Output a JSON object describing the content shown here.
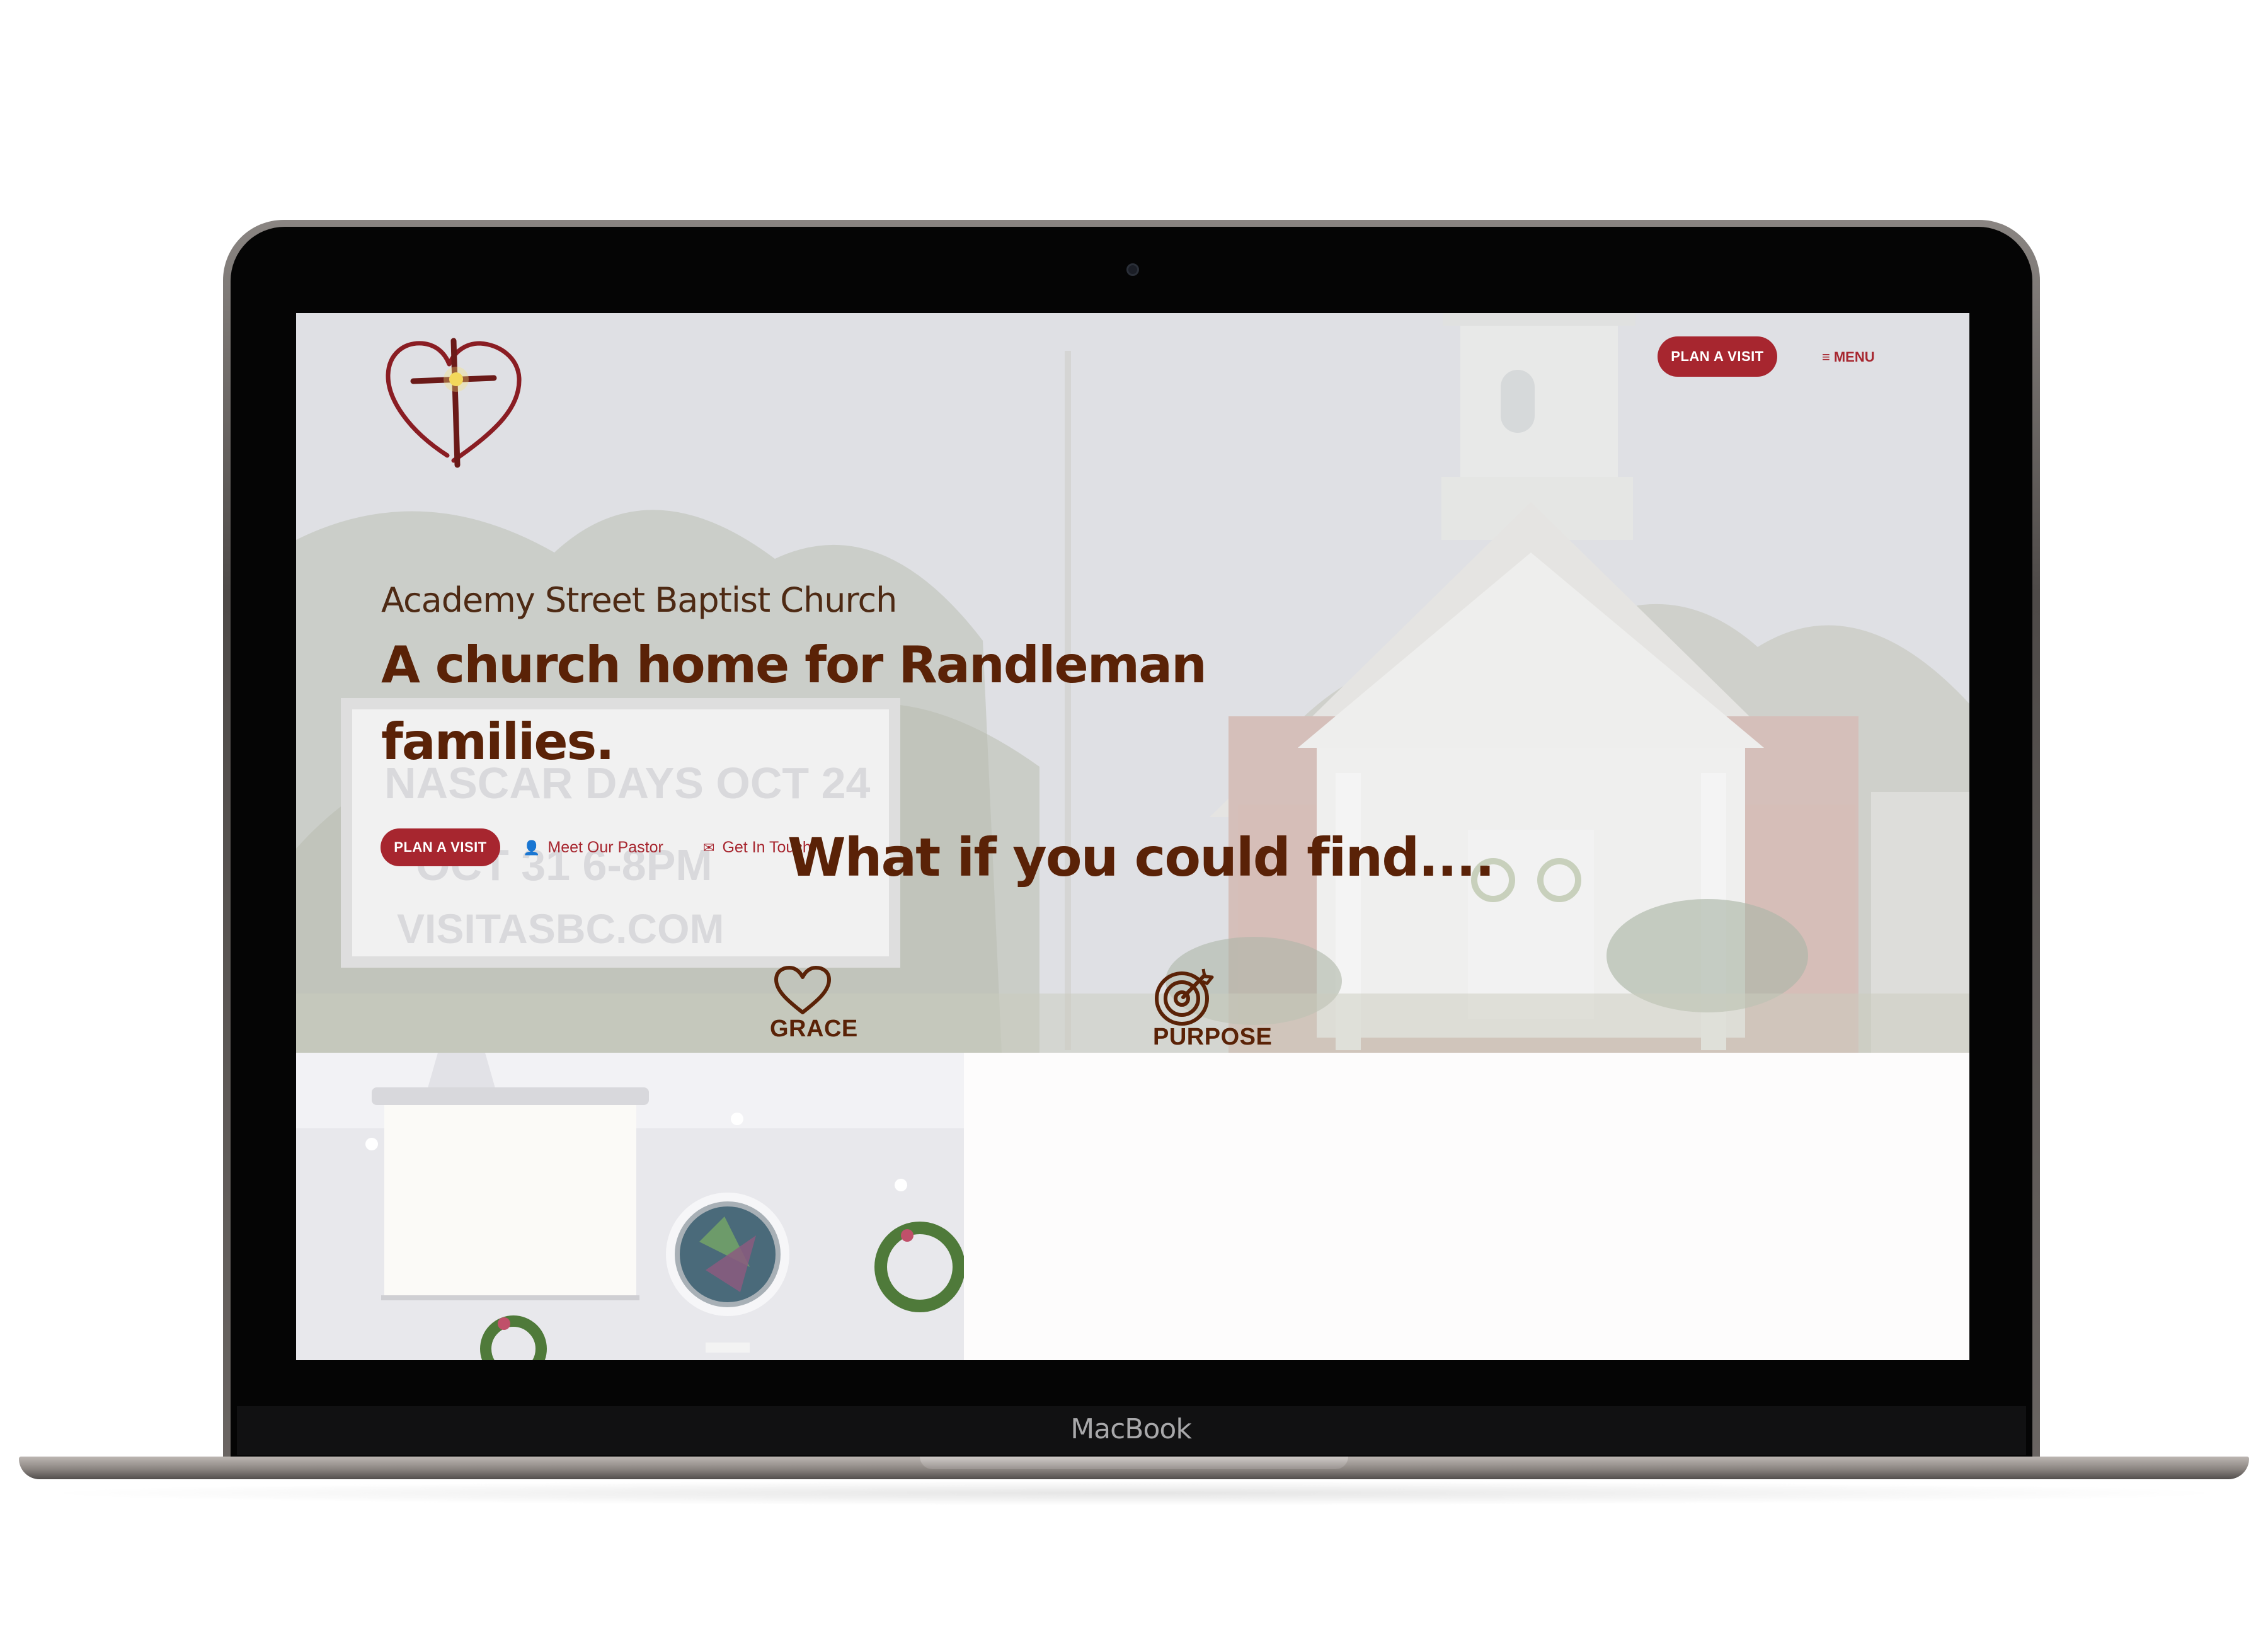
{
  "device": {
    "brand_text": "MacBook"
  },
  "header": {
    "plan_visit_label": "PLAN A VISIT",
    "menu_icon": "≡",
    "menu_label": "MENU"
  },
  "hero": {
    "subtitle": "Academy Street Baptist Church",
    "title_line1": "A church home for Randleman",
    "title_line2": "families.",
    "plan_visit_label": "PLAN A VISIT",
    "meet_pastor_icon": "👤",
    "meet_pastor_label": "Meet Our Pastor",
    "get_in_touch_icon": "✉",
    "get_in_touch_label": "Get In Touch",
    "sign_text": [
      "NASCAR DAYS OCT 24",
      "OCT 31 6-8PM",
      "VISITASBC.COM"
    ]
  },
  "find_section": {
    "heading": "What if you could find....",
    "features": [
      {
        "label": "GRACE",
        "icon": "heart-icon"
      },
      {
        "label": "PURPOSE",
        "icon": "target-icon"
      }
    ]
  },
  "colors": {
    "brand_red": "#a7262f",
    "heading_brown": "#5a2207"
  }
}
